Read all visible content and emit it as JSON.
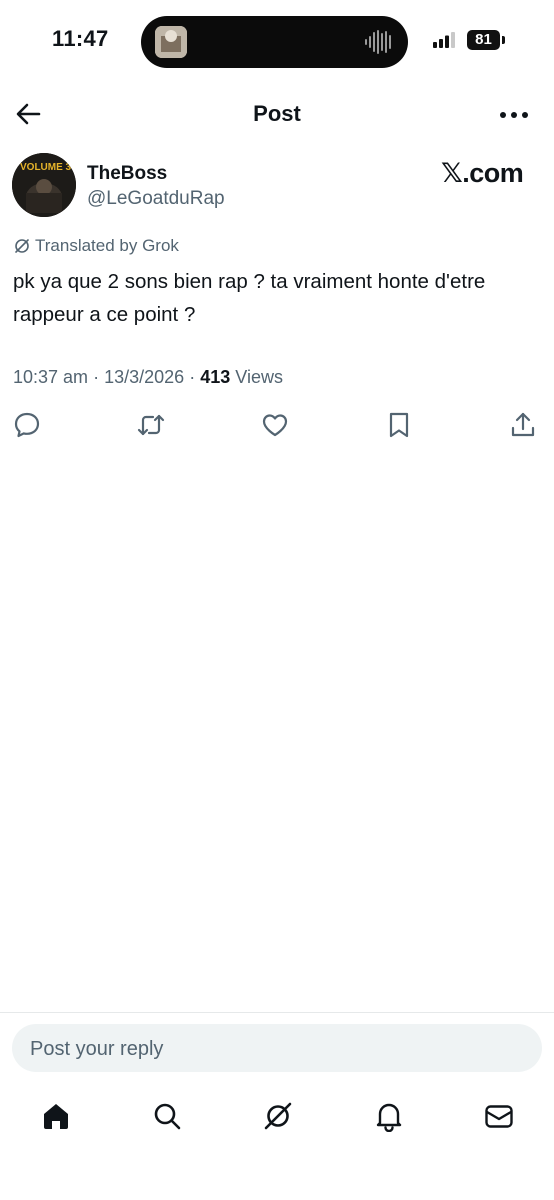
{
  "status_bar": {
    "time": "11:47",
    "battery": "81"
  },
  "header": {
    "title": "Post"
  },
  "post": {
    "author_name": "TheBoss",
    "author_handle": "@LeGoatduRap",
    "avatar_text": "VOLUME 3",
    "watermark": "𝕏.com",
    "translated_label": "Translated by Grok",
    "text": "pk ya que 2 sons bien rap ? ta vraiment honte d'etre rappeur a ce point ?",
    "time": "10:37 am",
    "date": "13/3/2026",
    "views_count": "413",
    "views_label": "Views",
    "separator": "·"
  },
  "actions": [
    "reply-icon",
    "repost-icon",
    "like-icon",
    "bookmark-icon",
    "share-icon"
  ],
  "reply": {
    "placeholder": "Post your reply"
  },
  "tab_bar": [
    "home-icon",
    "search-icon",
    "grok-icon",
    "notifications-icon",
    "messages-icon"
  ],
  "colors": {
    "text": "#0f1419",
    "secondary": "#536471",
    "reply_bg": "#eff3f4"
  }
}
